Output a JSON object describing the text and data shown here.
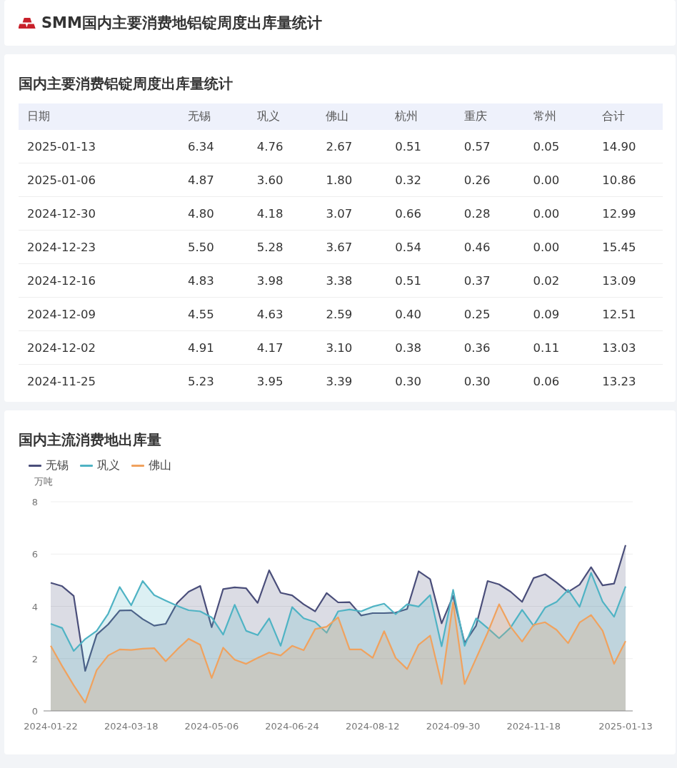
{
  "header": {
    "title": "SMM国内主要消费地铝锭周度出库量统计"
  },
  "table_card": {
    "title": "国内主要消费铝锭周度出库量统计",
    "columns": [
      "日期",
      "无锡",
      "巩义",
      "佛山",
      "杭州",
      "重庆",
      "常州",
      "合计"
    ],
    "rows": [
      [
        "2025-01-13",
        "6.34",
        "4.76",
        "2.67",
        "0.51",
        "0.57",
        "0.05",
        "14.90"
      ],
      [
        "2025-01-06",
        "4.87",
        "3.60",
        "1.80",
        "0.32",
        "0.26",
        "0.00",
        "10.86"
      ],
      [
        "2024-12-30",
        "4.80",
        "4.18",
        "3.07",
        "0.66",
        "0.28",
        "0.00",
        "12.99"
      ],
      [
        "2024-12-23",
        "5.50",
        "5.28",
        "3.67",
        "0.54",
        "0.46",
        "0.00",
        "15.45"
      ],
      [
        "2024-12-16",
        "4.83",
        "3.98",
        "3.38",
        "0.51",
        "0.37",
        "0.02",
        "13.09"
      ],
      [
        "2024-12-09",
        "4.55",
        "4.63",
        "2.59",
        "0.40",
        "0.25",
        "0.09",
        "12.51"
      ],
      [
        "2024-12-02",
        "4.91",
        "4.17",
        "3.10",
        "0.38",
        "0.36",
        "0.11",
        "13.03"
      ],
      [
        "2024-11-25",
        "5.23",
        "3.95",
        "3.39",
        "0.30",
        "0.30",
        "0.06",
        "13.23"
      ]
    ]
  },
  "chart_card": {
    "title": "国内主流消费地出库量",
    "chart_data": {
      "type": "area",
      "grid": true,
      "ylabel": "万吨",
      "ylim": [
        0,
        8
      ],
      "yticks": [
        0,
        2,
        4,
        6,
        8
      ],
      "categories": [
        "2024-01-22",
        null,
        null,
        null,
        null,
        null,
        null,
        "2024-03-18",
        null,
        null,
        null,
        null,
        null,
        null,
        "2024-05-06",
        null,
        null,
        null,
        null,
        null,
        null,
        "2024-06-24",
        null,
        null,
        null,
        null,
        null,
        null,
        "2024-08-12",
        null,
        null,
        null,
        null,
        null,
        null,
        "2024-09-30",
        null,
        null,
        null,
        null,
        null,
        null,
        "2024-11-18",
        null,
        null,
        null,
        null,
        null,
        null,
        null,
        "2025-01-13"
      ],
      "series": [
        {
          "name": "无锡",
          "color": "#4a4e7a",
          "values": [
            4.9,
            4.77,
            4.4,
            1.53,
            2.92,
            3.31,
            3.84,
            3.85,
            3.51,
            3.26,
            3.33,
            4.13,
            4.56,
            4.78,
            3.2,
            4.66,
            4.73,
            4.69,
            4.13,
            5.38,
            4.52,
            4.42,
            4.08,
            3.81,
            4.51,
            4.15,
            4.16,
            3.65,
            3.74,
            3.74,
            3.76,
            3.9,
            5.34,
            5.04,
            3.35,
            4.4,
            2.6,
            3.26,
            4.97,
            4.84,
            4.56,
            4.17,
            5.08,
            5.23,
            4.91,
            4.55,
            4.83,
            5.5,
            4.8,
            4.87,
            6.34
          ]
        },
        {
          "name": "巩义",
          "color": "#4fb3c4",
          "values": [
            3.33,
            3.17,
            2.29,
            2.75,
            3.06,
            3.72,
            4.74,
            4.04,
            4.97,
            4.43,
            4.22,
            4.02,
            3.85,
            3.81,
            3.58,
            2.92,
            4.06,
            3.06,
            2.9,
            3.54,
            2.49,
            3.97,
            3.54,
            3.4,
            2.99,
            3.81,
            3.88,
            3.81,
            3.99,
            4.1,
            3.7,
            4.08,
            3.99,
            4.43,
            2.47,
            4.63,
            2.49,
            3.54,
            3.17,
            2.78,
            3.19,
            3.87,
            3.26,
            3.95,
            4.17,
            4.63,
            3.98,
            5.28,
            4.18,
            3.6,
            4.76
          ]
        },
        {
          "name": "佛山",
          "color": "#f0a25e",
          "values": [
            2.49,
            1.71,
            0.98,
            0.32,
            1.56,
            2.12,
            2.35,
            2.33,
            2.38,
            2.4,
            1.9,
            2.35,
            2.76,
            2.53,
            1.26,
            2.42,
            1.96,
            1.8,
            2.03,
            2.23,
            2.12,
            2.49,
            2.32,
            3.13,
            3.22,
            3.58,
            2.35,
            2.35,
            2.03,
            3.05,
            2.03,
            1.6,
            2.53,
            2.88,
            1.03,
            4.15,
            1.03,
            2.01,
            2.99,
            4.08,
            3.22,
            2.65,
            3.29,
            3.39,
            3.1,
            2.59,
            3.38,
            3.67,
            3.07,
            1.8,
            2.67
          ]
        }
      ]
    }
  }
}
